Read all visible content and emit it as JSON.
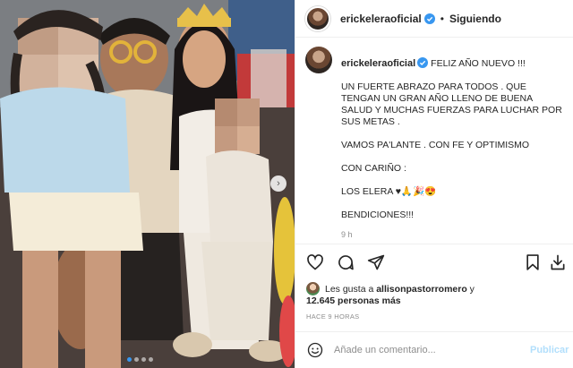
{
  "post": {
    "username": "erickeleraoficial",
    "header_separator": "•",
    "follow_status": "Siguiendo",
    "caption": {
      "line1": "FELIZ AÑO NUEVO !!!",
      "para1": "UN FUERTE ABRAZO PARA TODOS . QUE TENGAN UN GRAN AÑO LLENO DE BUENA SALUD Y MUCHAS FUERZAS PARA LUCHAR POR SUS METAS .",
      "para2": "VAMOS PA'LANTE . CON FE Y OPTIMISMO",
      "para3": "CON CARIÑO :",
      "para4": "LOS ELERA ♥🙏🎉😍",
      "para5": "BENDICIONES!!!",
      "time": "9 h"
    },
    "likes": {
      "prefix": "Les gusta a",
      "user": "allisonpastorromero",
      "conjunction": "y",
      "others": "12.645 personas más"
    },
    "posted_ago": "HACE 9 HORAS",
    "comment_input": {
      "placeholder": "Añade un comentario...",
      "value": ""
    },
    "publish_label": "Publicar",
    "carousel": {
      "count": 4,
      "active_index": 0
    }
  },
  "icons": {
    "like": "heart-icon",
    "comment": "comment-bubble-icon",
    "share": "paper-plane-icon",
    "save": "bookmark-icon",
    "download": "download-icon",
    "emoji": "smiley-icon",
    "verified": "verified-badge-icon",
    "next": "chevron-right-icon"
  },
  "colors": {
    "verified": "#3897f0",
    "publish_disabled": "#b2dffc",
    "secondary_text": "#8e8e8e",
    "active_dot": "#3797f0"
  }
}
